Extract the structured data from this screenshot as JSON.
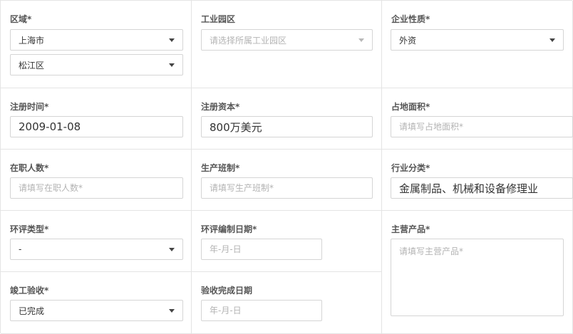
{
  "fields": {
    "region": {
      "label": "区域*",
      "province": "上海市",
      "district": "松江区"
    },
    "industrial_park": {
      "label": "工业园区",
      "placeholder": "请选择所属工业园区"
    },
    "enterprise_nature": {
      "label": "企业性质*",
      "value": "外资"
    },
    "registration_date": {
      "label": "注册时间*",
      "value": "2009-01-08"
    },
    "registered_capital": {
      "label": "注册资本*",
      "value": "800万美元"
    },
    "floor_area": {
      "label": "占地面积*",
      "placeholder": "请填写占地面积*"
    },
    "employees": {
      "label": "在职人数*",
      "placeholder": "请填写在职人数*"
    },
    "production_shift": {
      "label": "生产班制*",
      "placeholder": "请填写生产班制*"
    },
    "industry_category": {
      "label": "行业分类*",
      "value": "金属制品、机械和设备修理业"
    },
    "eia_type": {
      "label": "环评类型*",
      "value": "-"
    },
    "eia_date": {
      "label": "环评编制日期*",
      "placeholder": "年-月-日"
    },
    "main_products": {
      "label": "主营产品*",
      "placeholder": "请填写主营产品*"
    },
    "acceptance": {
      "label": "竣工验收*",
      "value": "已完成"
    },
    "acceptance_date": {
      "label": "验收完成日期",
      "placeholder": "年-月-日"
    }
  }
}
